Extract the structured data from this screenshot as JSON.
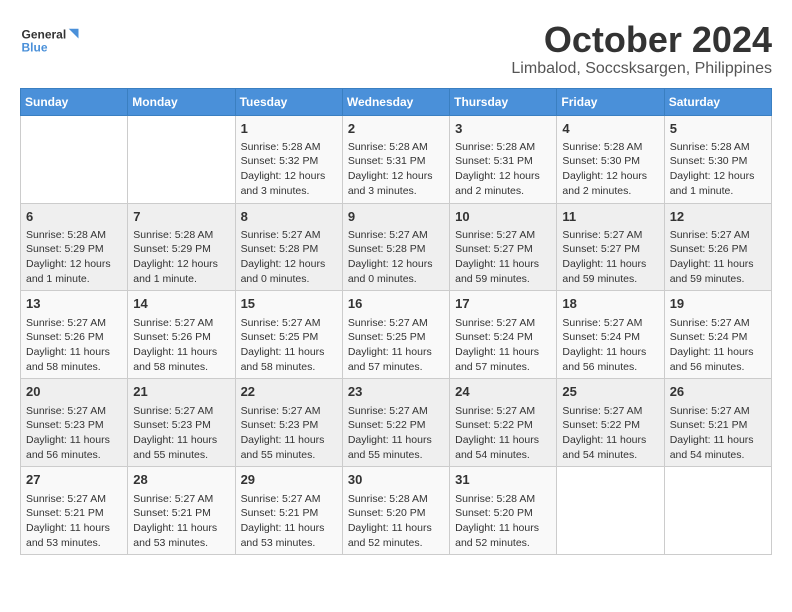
{
  "header": {
    "logo_line1": "General",
    "logo_line2": "Blue",
    "title": "October 2024",
    "subtitle": "Limbalod, Soccsksargen, Philippines"
  },
  "weekdays": [
    "Sunday",
    "Monday",
    "Tuesday",
    "Wednesday",
    "Thursday",
    "Friday",
    "Saturday"
  ],
  "weeks": [
    [
      {
        "day": "",
        "text": ""
      },
      {
        "day": "",
        "text": ""
      },
      {
        "day": "1",
        "text": "Sunrise: 5:28 AM\nSunset: 5:32 PM\nDaylight: 12 hours\nand 3 minutes."
      },
      {
        "day": "2",
        "text": "Sunrise: 5:28 AM\nSunset: 5:31 PM\nDaylight: 12 hours\nand 3 minutes."
      },
      {
        "day": "3",
        "text": "Sunrise: 5:28 AM\nSunset: 5:31 PM\nDaylight: 12 hours\nand 2 minutes."
      },
      {
        "day": "4",
        "text": "Sunrise: 5:28 AM\nSunset: 5:30 PM\nDaylight: 12 hours\nand 2 minutes."
      },
      {
        "day": "5",
        "text": "Sunrise: 5:28 AM\nSunset: 5:30 PM\nDaylight: 12 hours\nand 1 minute."
      }
    ],
    [
      {
        "day": "6",
        "text": "Sunrise: 5:28 AM\nSunset: 5:29 PM\nDaylight: 12 hours\nand 1 minute."
      },
      {
        "day": "7",
        "text": "Sunrise: 5:28 AM\nSunset: 5:29 PM\nDaylight: 12 hours\nand 1 minute."
      },
      {
        "day": "8",
        "text": "Sunrise: 5:27 AM\nSunset: 5:28 PM\nDaylight: 12 hours\nand 0 minutes."
      },
      {
        "day": "9",
        "text": "Sunrise: 5:27 AM\nSunset: 5:28 PM\nDaylight: 12 hours\nand 0 minutes."
      },
      {
        "day": "10",
        "text": "Sunrise: 5:27 AM\nSunset: 5:27 PM\nDaylight: 11 hours\nand 59 minutes."
      },
      {
        "day": "11",
        "text": "Sunrise: 5:27 AM\nSunset: 5:27 PM\nDaylight: 11 hours\nand 59 minutes."
      },
      {
        "day": "12",
        "text": "Sunrise: 5:27 AM\nSunset: 5:26 PM\nDaylight: 11 hours\nand 59 minutes."
      }
    ],
    [
      {
        "day": "13",
        "text": "Sunrise: 5:27 AM\nSunset: 5:26 PM\nDaylight: 11 hours\nand 58 minutes."
      },
      {
        "day": "14",
        "text": "Sunrise: 5:27 AM\nSunset: 5:26 PM\nDaylight: 11 hours\nand 58 minutes."
      },
      {
        "day": "15",
        "text": "Sunrise: 5:27 AM\nSunset: 5:25 PM\nDaylight: 11 hours\nand 58 minutes."
      },
      {
        "day": "16",
        "text": "Sunrise: 5:27 AM\nSunset: 5:25 PM\nDaylight: 11 hours\nand 57 minutes."
      },
      {
        "day": "17",
        "text": "Sunrise: 5:27 AM\nSunset: 5:24 PM\nDaylight: 11 hours\nand 57 minutes."
      },
      {
        "day": "18",
        "text": "Sunrise: 5:27 AM\nSunset: 5:24 PM\nDaylight: 11 hours\nand 56 minutes."
      },
      {
        "day": "19",
        "text": "Sunrise: 5:27 AM\nSunset: 5:24 PM\nDaylight: 11 hours\nand 56 minutes."
      }
    ],
    [
      {
        "day": "20",
        "text": "Sunrise: 5:27 AM\nSunset: 5:23 PM\nDaylight: 11 hours\nand 56 minutes."
      },
      {
        "day": "21",
        "text": "Sunrise: 5:27 AM\nSunset: 5:23 PM\nDaylight: 11 hours\nand 55 minutes."
      },
      {
        "day": "22",
        "text": "Sunrise: 5:27 AM\nSunset: 5:23 PM\nDaylight: 11 hours\nand 55 minutes."
      },
      {
        "day": "23",
        "text": "Sunrise: 5:27 AM\nSunset: 5:22 PM\nDaylight: 11 hours\nand 55 minutes."
      },
      {
        "day": "24",
        "text": "Sunrise: 5:27 AM\nSunset: 5:22 PM\nDaylight: 11 hours\nand 54 minutes."
      },
      {
        "day": "25",
        "text": "Sunrise: 5:27 AM\nSunset: 5:22 PM\nDaylight: 11 hours\nand 54 minutes."
      },
      {
        "day": "26",
        "text": "Sunrise: 5:27 AM\nSunset: 5:21 PM\nDaylight: 11 hours\nand 54 minutes."
      }
    ],
    [
      {
        "day": "27",
        "text": "Sunrise: 5:27 AM\nSunset: 5:21 PM\nDaylight: 11 hours\nand 53 minutes."
      },
      {
        "day": "28",
        "text": "Sunrise: 5:27 AM\nSunset: 5:21 PM\nDaylight: 11 hours\nand 53 minutes."
      },
      {
        "day": "29",
        "text": "Sunrise: 5:27 AM\nSunset: 5:21 PM\nDaylight: 11 hours\nand 53 minutes."
      },
      {
        "day": "30",
        "text": "Sunrise: 5:28 AM\nSunset: 5:20 PM\nDaylight: 11 hours\nand 52 minutes."
      },
      {
        "day": "31",
        "text": "Sunrise: 5:28 AM\nSunset: 5:20 PM\nDaylight: 11 hours\nand 52 minutes."
      },
      {
        "day": "",
        "text": ""
      },
      {
        "day": "",
        "text": ""
      }
    ]
  ]
}
